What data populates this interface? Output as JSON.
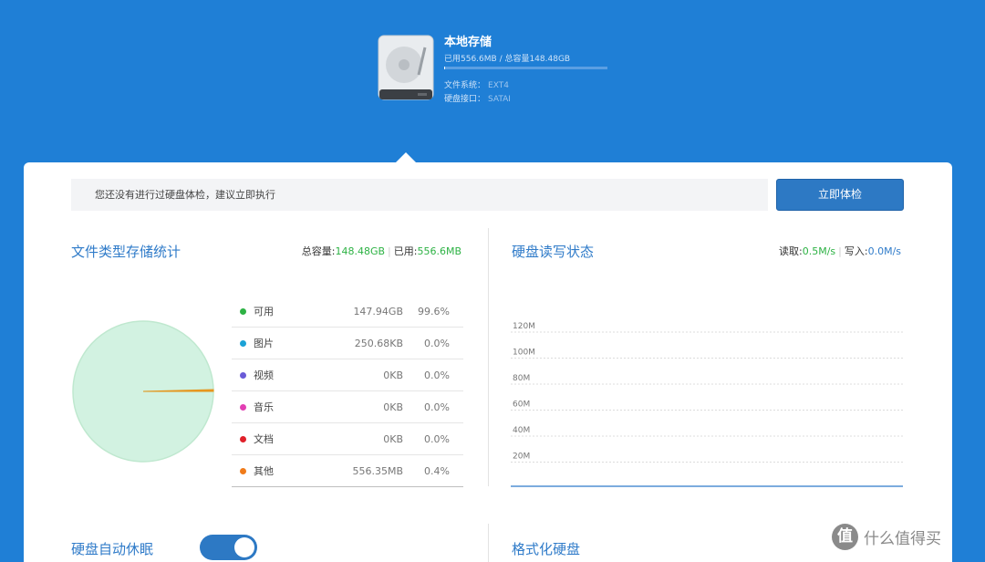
{
  "disk": {
    "title": "本地存储",
    "usage_text": "已用556.6MB / 总容量148.48GB",
    "used_fraction": 0.004,
    "filesystem_label": "文件系统：",
    "filesystem_value": "EXT4",
    "interface_label": "硬盘接口：",
    "interface_value": "SATAI",
    "icon": "hard-disk-icon"
  },
  "notice": {
    "text": "您还没有进行过硬盘体检，建议立即执行",
    "button_label": "立即体检"
  },
  "storage_stats": {
    "title": "文件类型存储统计",
    "total_label": "总容量:",
    "total_value": "148.48GB",
    "used_label": "已用:",
    "used_value": "556.6MB",
    "items": [
      {
        "name": "可用",
        "size": "147.94GB",
        "pct": "99.6%",
        "color": "#2db244"
      },
      {
        "name": "图片",
        "size": "250.68KB",
        "pct": "0.0%",
        "color": "#1ba2d6"
      },
      {
        "name": "视频",
        "size": "0KB",
        "pct": "0.0%",
        "color": "#6a5bd7"
      },
      {
        "name": "音乐",
        "size": "0KB",
        "pct": "0.0%",
        "color": "#e23fb3"
      },
      {
        "name": "文档",
        "size": "0KB",
        "pct": "0.0%",
        "color": "#e0202a"
      },
      {
        "name": "其他",
        "size": "556.35MB",
        "pct": "0.4%",
        "color": "#f07b1a"
      }
    ]
  },
  "chart_data": [
    {
      "type": "pie",
      "labels": [
        "可用",
        "图片",
        "视频",
        "音乐",
        "文档",
        "其他"
      ],
      "values": [
        99.6,
        0.0,
        0.0,
        0.0,
        0.0,
        0.4
      ],
      "colors": [
        "#d2f2e1",
        "#1ba2d6",
        "#6a5bd7",
        "#e23fb3",
        "#e0202a",
        "#e8961e"
      ]
    },
    {
      "type": "line",
      "title": "",
      "y_ticks": [
        "120M",
        "100M",
        "80M",
        "60M",
        "40M",
        "20M"
      ],
      "ylim": [
        0,
        120
      ],
      "series": [
        {
          "values": [
            0,
            0,
            0,
            0,
            0,
            0,
            0,
            0,
            0,
            0
          ]
        }
      ]
    }
  ],
  "io_status": {
    "title": "硬盘读写状态",
    "read_label": "读取:",
    "read_value": "0.5M/s",
    "write_label": "写入:",
    "write_value": "0.0M/s"
  },
  "sleep": {
    "label": "硬盘自动休眠",
    "enabled": true
  },
  "format": {
    "label": "格式化硬盘"
  },
  "watermark": {
    "glyph": "值",
    "text": "什么值得买"
  }
}
